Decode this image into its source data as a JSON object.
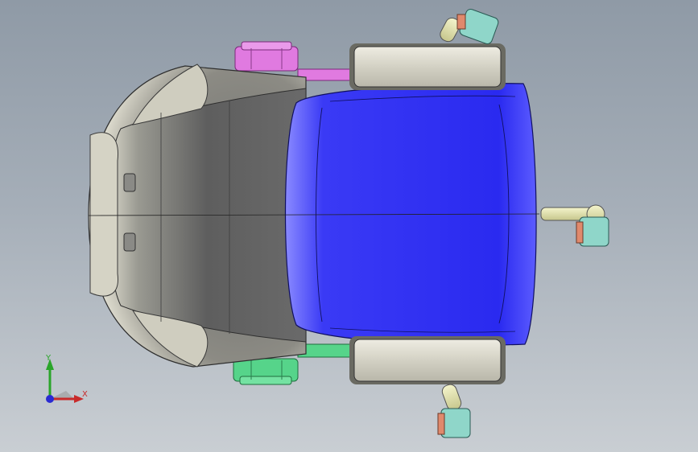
{
  "viewport": {
    "background_top": "#8f9aa6",
    "background_bottom": "#c9ced3"
  },
  "model": {
    "description_parts": [
      "shell",
      "seat",
      "armrest-left",
      "armrest-right",
      "caster-top",
      "caster-right",
      "caster-bottom",
      "hinge-top",
      "hinge-bottom"
    ],
    "colors": {
      "shell": "#5f5f5f",
      "shell_rim": "#c9c7b9",
      "seat": "#2f2ff2",
      "armrest": "#d7d5c8",
      "hinge_top": "#e07ae0",
      "hinge_bottom": "#56d48a",
      "strut": "#e6e6b0",
      "caster_wheel": "#8fd6c9",
      "caster_hub": "#e0896c"
    }
  },
  "triad": {
    "x_label": "X",
    "y_label": "Y",
    "x_color": "#c82a2a",
    "y_color": "#2aa52a",
    "z_color": "#2a2ad2"
  }
}
